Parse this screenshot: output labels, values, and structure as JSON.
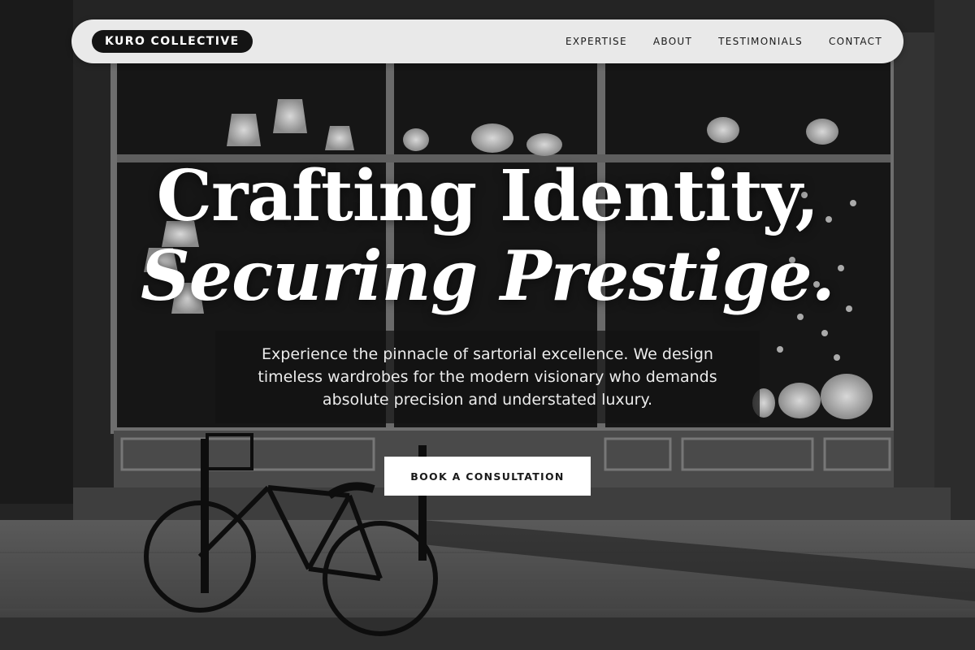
{
  "nav": {
    "brand": "KURO COLLECTIVE",
    "links": [
      "EXPERTISE",
      "ABOUT",
      "TESTIMONIALS",
      "CONTACT"
    ]
  },
  "hero": {
    "title_line1": "Crafting Identity,",
    "title_line2": "Securing Prestige.",
    "subtitle": "Experience the pinnacle of sartorial excellence. We design timeless wardrobes for the modern visionary who demands absolute precision and understated luxury.",
    "cta_label": "BOOK A CONSULTATION"
  },
  "colors": {
    "nav_background": "#e9e9e9",
    "brand_pill": "#141414",
    "cta_background": "#ffffff",
    "hero_text": "#ffffff"
  },
  "icons": [
    "bicycle-image",
    "storefront-photo"
  ]
}
